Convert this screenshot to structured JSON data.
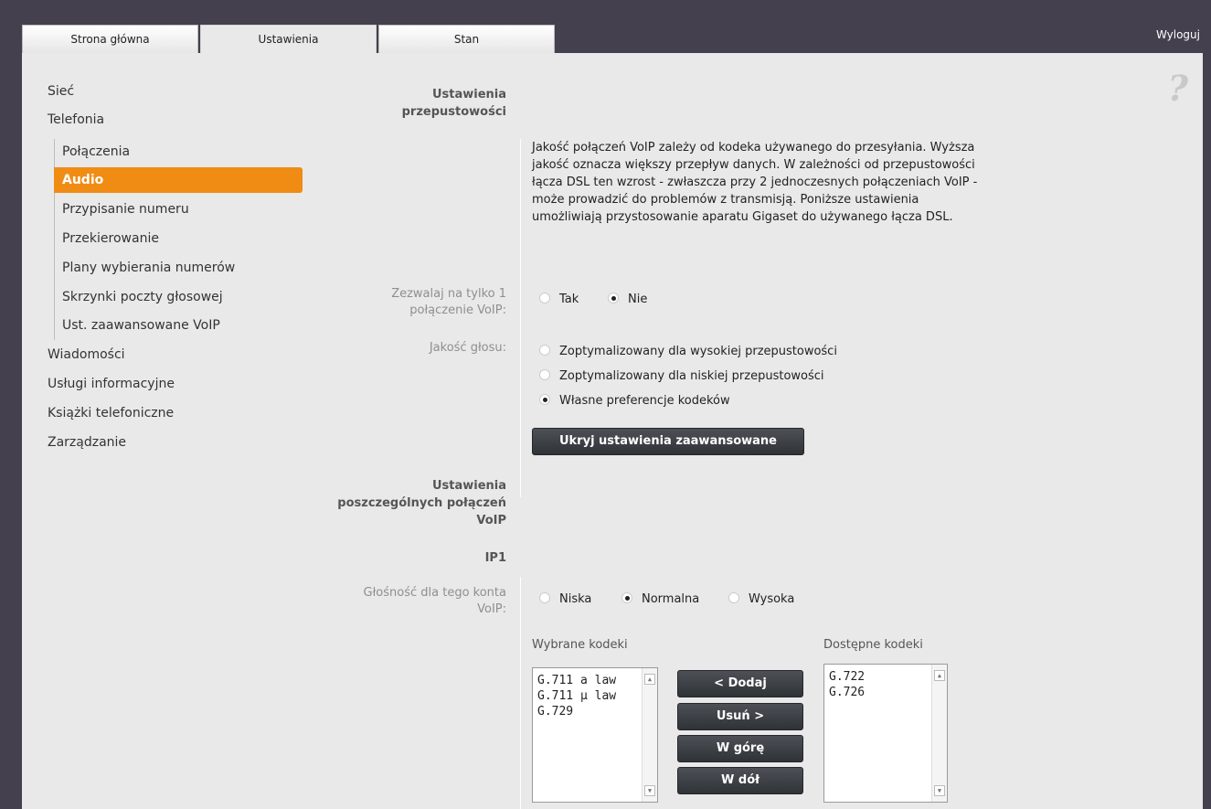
{
  "tabs": [
    {
      "label": "Strona główna"
    },
    {
      "label": "Ustawienia"
    },
    {
      "label": "Stan"
    }
  ],
  "logout_label": "Wyloguj",
  "help_glyph": "?",
  "sidebar": {
    "top1": "Sieć",
    "top2": "Telefonia",
    "sub": [
      {
        "label": "Połączenia"
      },
      {
        "label": "Audio"
      },
      {
        "label": "Przypisanie numeru"
      },
      {
        "label": "Przekierowanie"
      },
      {
        "label": "Plany wybierania numerów"
      },
      {
        "label": "Skrzynki poczty głosowej"
      },
      {
        "label": "Ust. zaawansowane VoIP"
      }
    ],
    "top3": "Wiadomości",
    "top4": "Usługi informacyjne",
    "top5": "Książki telefoniczne",
    "top6": "Zarządzanie"
  },
  "bandwidth": {
    "head_line1": "Ustawienia",
    "head_line2": "przepustowości",
    "description": "Jakość połączeń VoIP zależy od kodeka używanego do przesyłania. Wyższa jakość oznacza większy przepływ danych. W zależności od przepustowości łącza DSL ten wzrost - zwłaszcza przy 2 jednoczesnych połączeniach VoIP - może prowadzić do problemów z transmisją. Poniższe ustawienia umożliwiają przystosowanie aparatu Gigaset do używanego łącza DSL.",
    "single_line1": "Zezwalaj na tylko 1",
    "single_line2": "połączenie VoIP:",
    "single_yes": "Tak",
    "single_no": "Nie",
    "quality_label": "Jakość głosu:",
    "quality_opt1": "Zoptymalizowany dla wysokiej przepustowości",
    "quality_opt2": "Zoptymalizowany dla niskiej przepustowości",
    "quality_opt3": "Własne preferencje kodeków",
    "hide_advanced": "Ukryj ustawienia zaawansowane"
  },
  "per_connection": {
    "head_line1": "Ustawienia",
    "head_line2": "poszczególnych połączeń",
    "head_line3": "VoIP",
    "account": "IP1",
    "volume_line1": "Głośność dla tego konta",
    "volume_line2": "VoIP:",
    "vol_low": "Niska",
    "vol_normal": "Normalna",
    "vol_high": "Wysoka",
    "selected_head": "Wybrane kodeki",
    "available_head": "Dostępne kodeki",
    "selected_codecs": [
      "G.711 a law",
      "G.711 µ law",
      "G.729"
    ],
    "available_codecs": [
      "G.722",
      "G.726"
    ],
    "btn_add": "< Dodaj",
    "btn_remove": "Usuń >",
    "btn_up": "W górę",
    "btn_down": "W dół"
  }
}
